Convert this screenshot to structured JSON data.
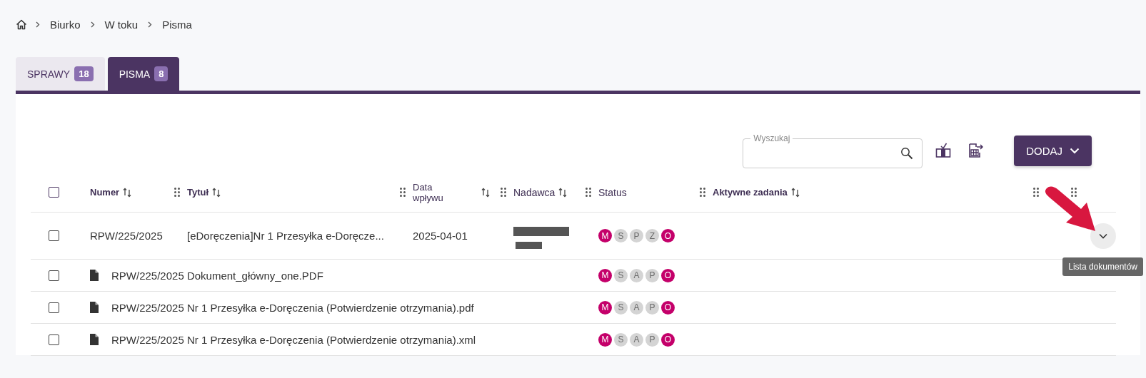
{
  "breadcrumb": [
    "Biurko",
    "W toku",
    "Pisma"
  ],
  "tabs": [
    {
      "label": "SPRAWY",
      "count": "18",
      "selected": false
    },
    {
      "label": "PISMA",
      "count": "8",
      "selected": true
    }
  ],
  "search": {
    "label": "Wyszukaj"
  },
  "add_button": "DODAJ",
  "select_all": {
    "checked": false
  },
  "columns": [
    {
      "label": "Numer",
      "sortable": true
    },
    {
      "label": "Tytuł",
      "sortable": true
    },
    {
      "label": "Data wpływu",
      "sortable": true
    },
    {
      "label": "Nadawca",
      "sortable": true
    },
    {
      "label": "Status",
      "sortable": false
    },
    {
      "label": "Aktywne zadania",
      "sortable": true
    },
    {
      "sortable": false
    }
  ],
  "rows": [
    {
      "checked": false,
      "number": "RPW/225/2025",
      "title": "[eDoręczenia]Nr 1 Przesyłka e-Doręcze...",
      "date": "2025-04-01",
      "statuses": [
        {
          "letter": "M",
          "active": true
        },
        {
          "letter": "S",
          "active": false
        },
        {
          "letter": "P",
          "active": false
        },
        {
          "letter": "Z",
          "active": false
        },
        {
          "letter": "O",
          "active": true
        }
      ]
    }
  ],
  "documents": [
    {
      "checked": false,
      "name": "RPW/225/2025 Dokument_główny_one.PDF",
      "statuses": [
        {
          "letter": "M",
          "active": true
        },
        {
          "letter": "S",
          "active": false
        },
        {
          "letter": "A",
          "active": false
        },
        {
          "letter": "P",
          "active": false
        },
        {
          "letter": "O",
          "active": true
        }
      ]
    },
    {
      "checked": false,
      "name": "RPW/225/2025 Nr 1 Przesyłka e-Doręczenia (Potwierdzenie otrzymania).pdf",
      "statuses": [
        {
          "letter": "M",
          "active": true
        },
        {
          "letter": "S",
          "active": false
        },
        {
          "letter": "A",
          "active": false
        },
        {
          "letter": "P",
          "active": false
        },
        {
          "letter": "O",
          "active": true
        }
      ]
    },
    {
      "checked": false,
      "name": "RPW/225/2025 Nr 1 Przesyłka e-Doręczenia (Potwierdzenie otrzymania).xml",
      "statuses": [
        {
          "letter": "M",
          "active": true
        },
        {
          "letter": "S",
          "active": false
        },
        {
          "letter": "A",
          "active": false
        },
        {
          "letter": "P",
          "active": false
        },
        {
          "letter": "O",
          "active": true
        }
      ]
    }
  ],
  "tooltip": "Lista dokumentów"
}
